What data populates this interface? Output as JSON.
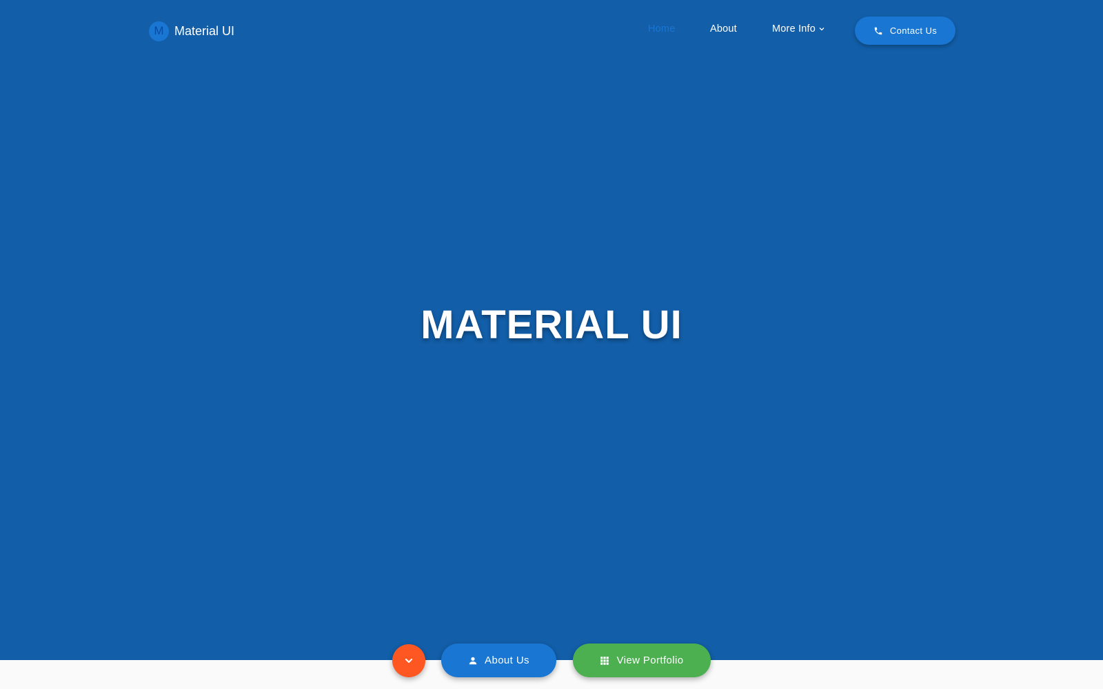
{
  "brand": {
    "logo_letter": "M",
    "name": "Material UI"
  },
  "nav": {
    "items": [
      {
        "label": "Home",
        "active": true
      },
      {
        "label": "About",
        "active": false
      },
      {
        "label": "More Info",
        "active": false,
        "has_dropdown": true
      }
    ],
    "contact_button": {
      "label": "Contact Us",
      "icon": "phone-icon"
    }
  },
  "hero": {
    "title": "MATERIAL UI"
  },
  "actions": {
    "scroll_down_icon": "chevron-down-icon",
    "about_button": {
      "label": "About Us",
      "icon": "person-icon"
    },
    "portfolio_button": {
      "label": "View Portfolio",
      "icon": "grid-icon"
    }
  },
  "colors": {
    "hero_background": "#125ea8",
    "primary": "#1976d2",
    "accent_orange": "#ff5722",
    "accent_green": "#4caf50",
    "page_background": "#fafafa"
  }
}
